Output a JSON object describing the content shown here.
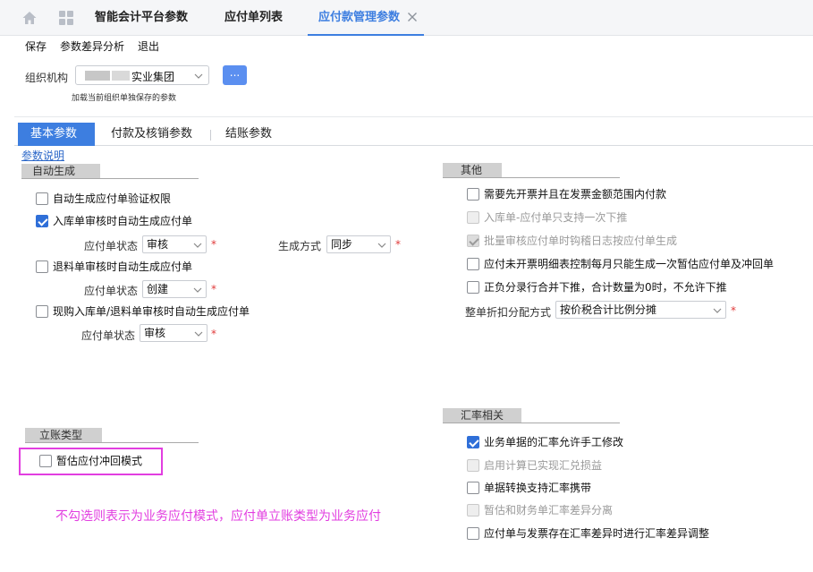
{
  "top_tabs": [
    {
      "label": "智能会计平台参数"
    },
    {
      "label": "应付单列表"
    },
    {
      "label": "应付款管理参数",
      "active": true
    }
  ],
  "toolbar": {
    "save": "保存",
    "diff": "参数差异分析",
    "exit": "退出"
  },
  "org": {
    "label": "组织机构",
    "value": "实业集团",
    "button": "...",
    "hint": "加载当前组织单独保存的参数"
  },
  "sub_tabs": [
    "基本参数",
    "付款及核销参数",
    "结账参数"
  ],
  "help_link": "参数说明",
  "auto_gen": {
    "title": "自动生成",
    "items": [
      {
        "label": "自动生成应付单验证权限",
        "checked": false
      },
      {
        "label": "入库单审核时自动生成应付单",
        "checked": true
      },
      {
        "label": "退料单审核时自动生成应付单",
        "checked": false
      },
      {
        "label": "现购入库单/退料单审核时自动生成应付单",
        "checked": false
      }
    ],
    "status_label": "应付单状态",
    "status1": "审核",
    "gen_mode_label": "生成方式",
    "gen_mode": "同步",
    "status2": "创建",
    "status3": "审核"
  },
  "booking": {
    "title": "立账类型",
    "item": {
      "label": "暂估应付冲回模式",
      "checked": false
    }
  },
  "other": {
    "title": "其他",
    "items": [
      {
        "label": "需要先开票并且在发票金额范围内付款",
        "checked": false,
        "disabled": false
      },
      {
        "label": "入库单-应付单只支持一次下推",
        "checked": false,
        "disabled": true
      },
      {
        "label": "批量审核应付单时钩稽日志按应付单生成",
        "checked": true,
        "disabled": true
      },
      {
        "label": "应付未开票明细表控制每月只能生成一次暂估应付单及冲回单",
        "checked": false,
        "disabled": false
      },
      {
        "label": "正负分录行合并下推，合计数量为0时，不允许下推",
        "checked": false,
        "disabled": false
      }
    ],
    "discount_label": "整单折扣分配方式",
    "discount_value": "按价税合计比例分摊"
  },
  "fx": {
    "title": "汇率相关",
    "items": [
      {
        "label": "业务单据的汇率允许手工修改",
        "checked": true,
        "disabled": false
      },
      {
        "label": "启用计算已实现汇兑损益",
        "checked": false,
        "disabled": true
      },
      {
        "label": "单据转换支持汇率携带",
        "checked": false,
        "disabled": false
      },
      {
        "label": "暂估和财务单汇率差异分离",
        "checked": false,
        "disabled": true
      },
      {
        "label": "应付单与发票存在汇率差异时进行汇率差异调整",
        "checked": false,
        "disabled": false
      }
    ]
  },
  "annotation": "不勾选则表示为业务应付模式，应付单立账类型为业务应付",
  "colors": {
    "accent": "#3d7ee0",
    "annotation": "#e23ee0",
    "required": "#e03a3a"
  }
}
